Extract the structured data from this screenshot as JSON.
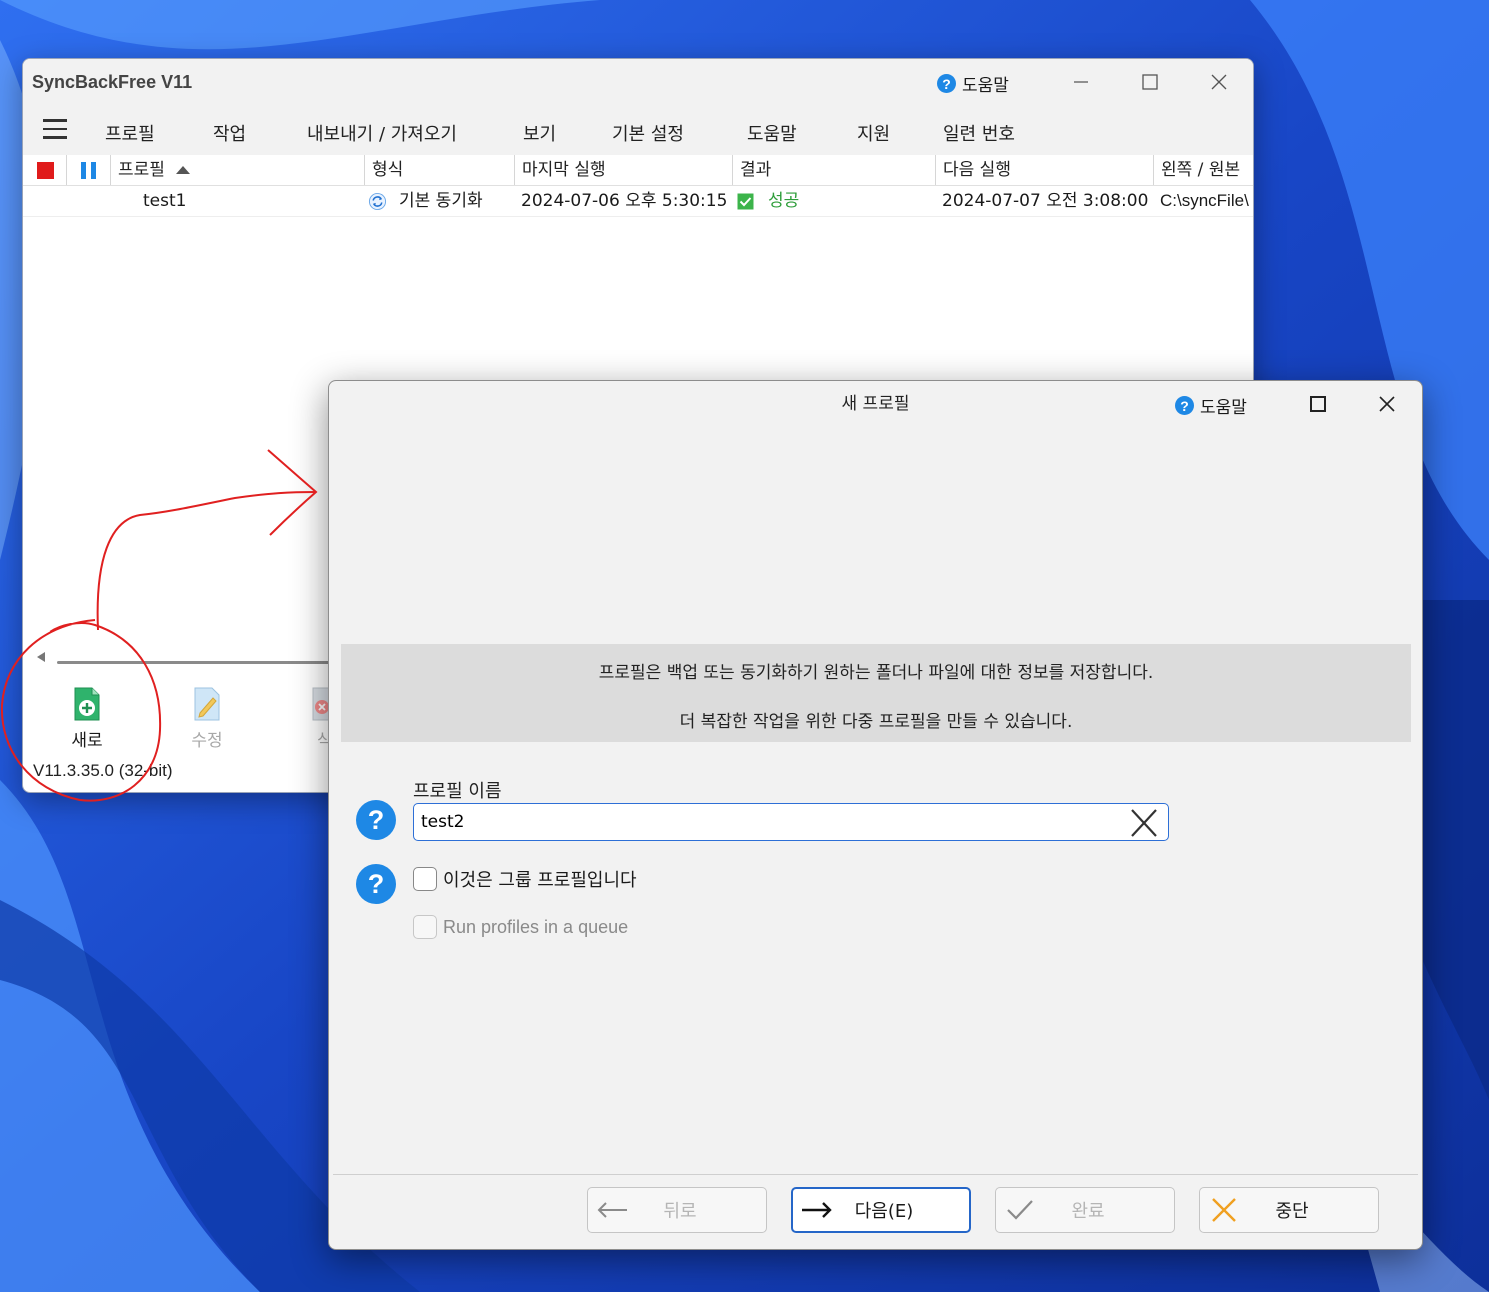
{
  "main_window": {
    "title": "SyncBackFree V11",
    "help_label": "도움말",
    "help_glyph": "?",
    "menu": [
      "프로필",
      "작업",
      "내보내기 / 가져오기",
      "보기",
      "기본 설정",
      "도움말",
      "지원",
      "일련 번호"
    ],
    "columns": {
      "profile": "프로필",
      "type": "형식",
      "last_run": "마지막 실행",
      "result": "결과",
      "next_run": "다음 실행",
      "left_source": "왼쪽 / 원본"
    },
    "rows": [
      {
        "profile": "test1",
        "type": "기본 동기화",
        "last_run": "2024-07-06 오후 5:30:15",
        "result": "성공",
        "next_run": "2024-07-07 오전 3:08:00",
        "left_source": "C:\\syncFile\\"
      }
    ],
    "toolbar": {
      "new": "새로",
      "edit": "수정",
      "delete": "삭"
    },
    "version": "V11.3.35.0 (32-bit)"
  },
  "dialog": {
    "title": "새 프로필",
    "help_label": "도움말",
    "help_glyph": "?",
    "info_line1": "프로필은 백업 또는 동기화하기 원하는 폴더나 파일에 대한 정보를 저장합니다.",
    "info_line2": "더 복잡한 작업을 위한 다중 프로필을 만들 수 있습니다.",
    "question_glyph": "?",
    "profile_name_label": "프로필 이름",
    "profile_name_value": "test2",
    "group_profile_label": "이것은 그룹 프로필입니다",
    "run_queue_label": "Run profiles in a queue",
    "buttons": {
      "back": "뒤로",
      "next": "다음(E)",
      "finish": "완료",
      "cancel": "중단"
    }
  },
  "colors": {
    "accent": "#2566c8",
    "success": "#2e9d3a",
    "stop": "#e01b1b",
    "pause": "#1e88e5",
    "annotation": "#e02020"
  }
}
